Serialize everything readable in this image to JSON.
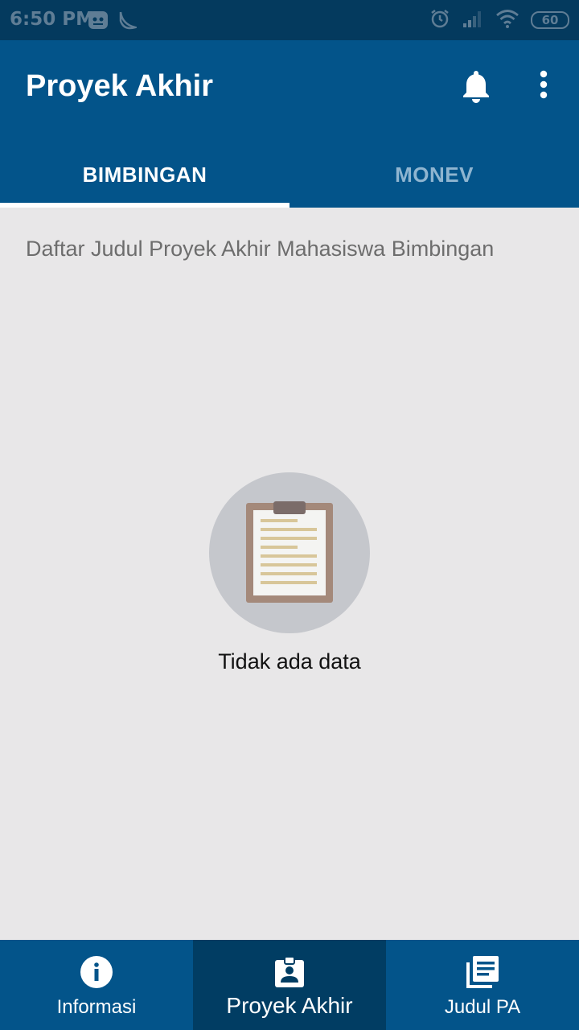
{
  "status_bar": {
    "time": "6:50 PM",
    "battery": "60",
    "icons": [
      "notification-app-icon",
      "moon-icon",
      "alarm-icon",
      "signal-icon",
      "wifi-icon",
      "battery-icon"
    ]
  },
  "app_bar": {
    "title": "Proyek Akhir",
    "actions": [
      "bell-icon",
      "more-vert-icon"
    ]
  },
  "tabs": [
    {
      "label": "BIMBINGAN",
      "active": true
    },
    {
      "label": "MONEV",
      "active": false
    }
  ],
  "content": {
    "heading": "Daftar Judul Proyek Akhir Mahasiswa Bimbingan",
    "empty_state": {
      "icon": "clipboard-icon",
      "text": "Tidak ada data"
    }
  },
  "bottom_nav": {
    "items": [
      {
        "label": "Informasi",
        "icon": "info-icon",
        "active": false
      },
      {
        "label": "Proyek Akhir",
        "icon": "badge-icon",
        "active": true
      },
      {
        "label": "Judul PA",
        "icon": "library-books-icon",
        "active": false
      }
    ]
  },
  "colors": {
    "status_bar": "#043a5e",
    "app_bar": "#03548a",
    "bottom_nav_active": "#013d63",
    "background": "#e8e7e8"
  }
}
